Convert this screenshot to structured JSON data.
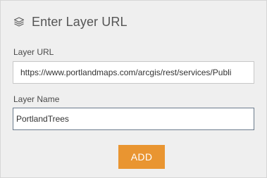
{
  "header": {
    "icon": "layers-icon",
    "title": "Enter Layer URL"
  },
  "form": {
    "layer_url": {
      "label": "Layer URL",
      "value": "https://www.portlandmaps.com/arcgis/rest/services/Publi"
    },
    "layer_name": {
      "label": "Layer Name",
      "value": "PortlandTrees"
    },
    "add_label": "ADD"
  },
  "colors": {
    "panel_bg": "#efefef",
    "accent": "#e99531",
    "focus_border": "#6b7a8c"
  }
}
